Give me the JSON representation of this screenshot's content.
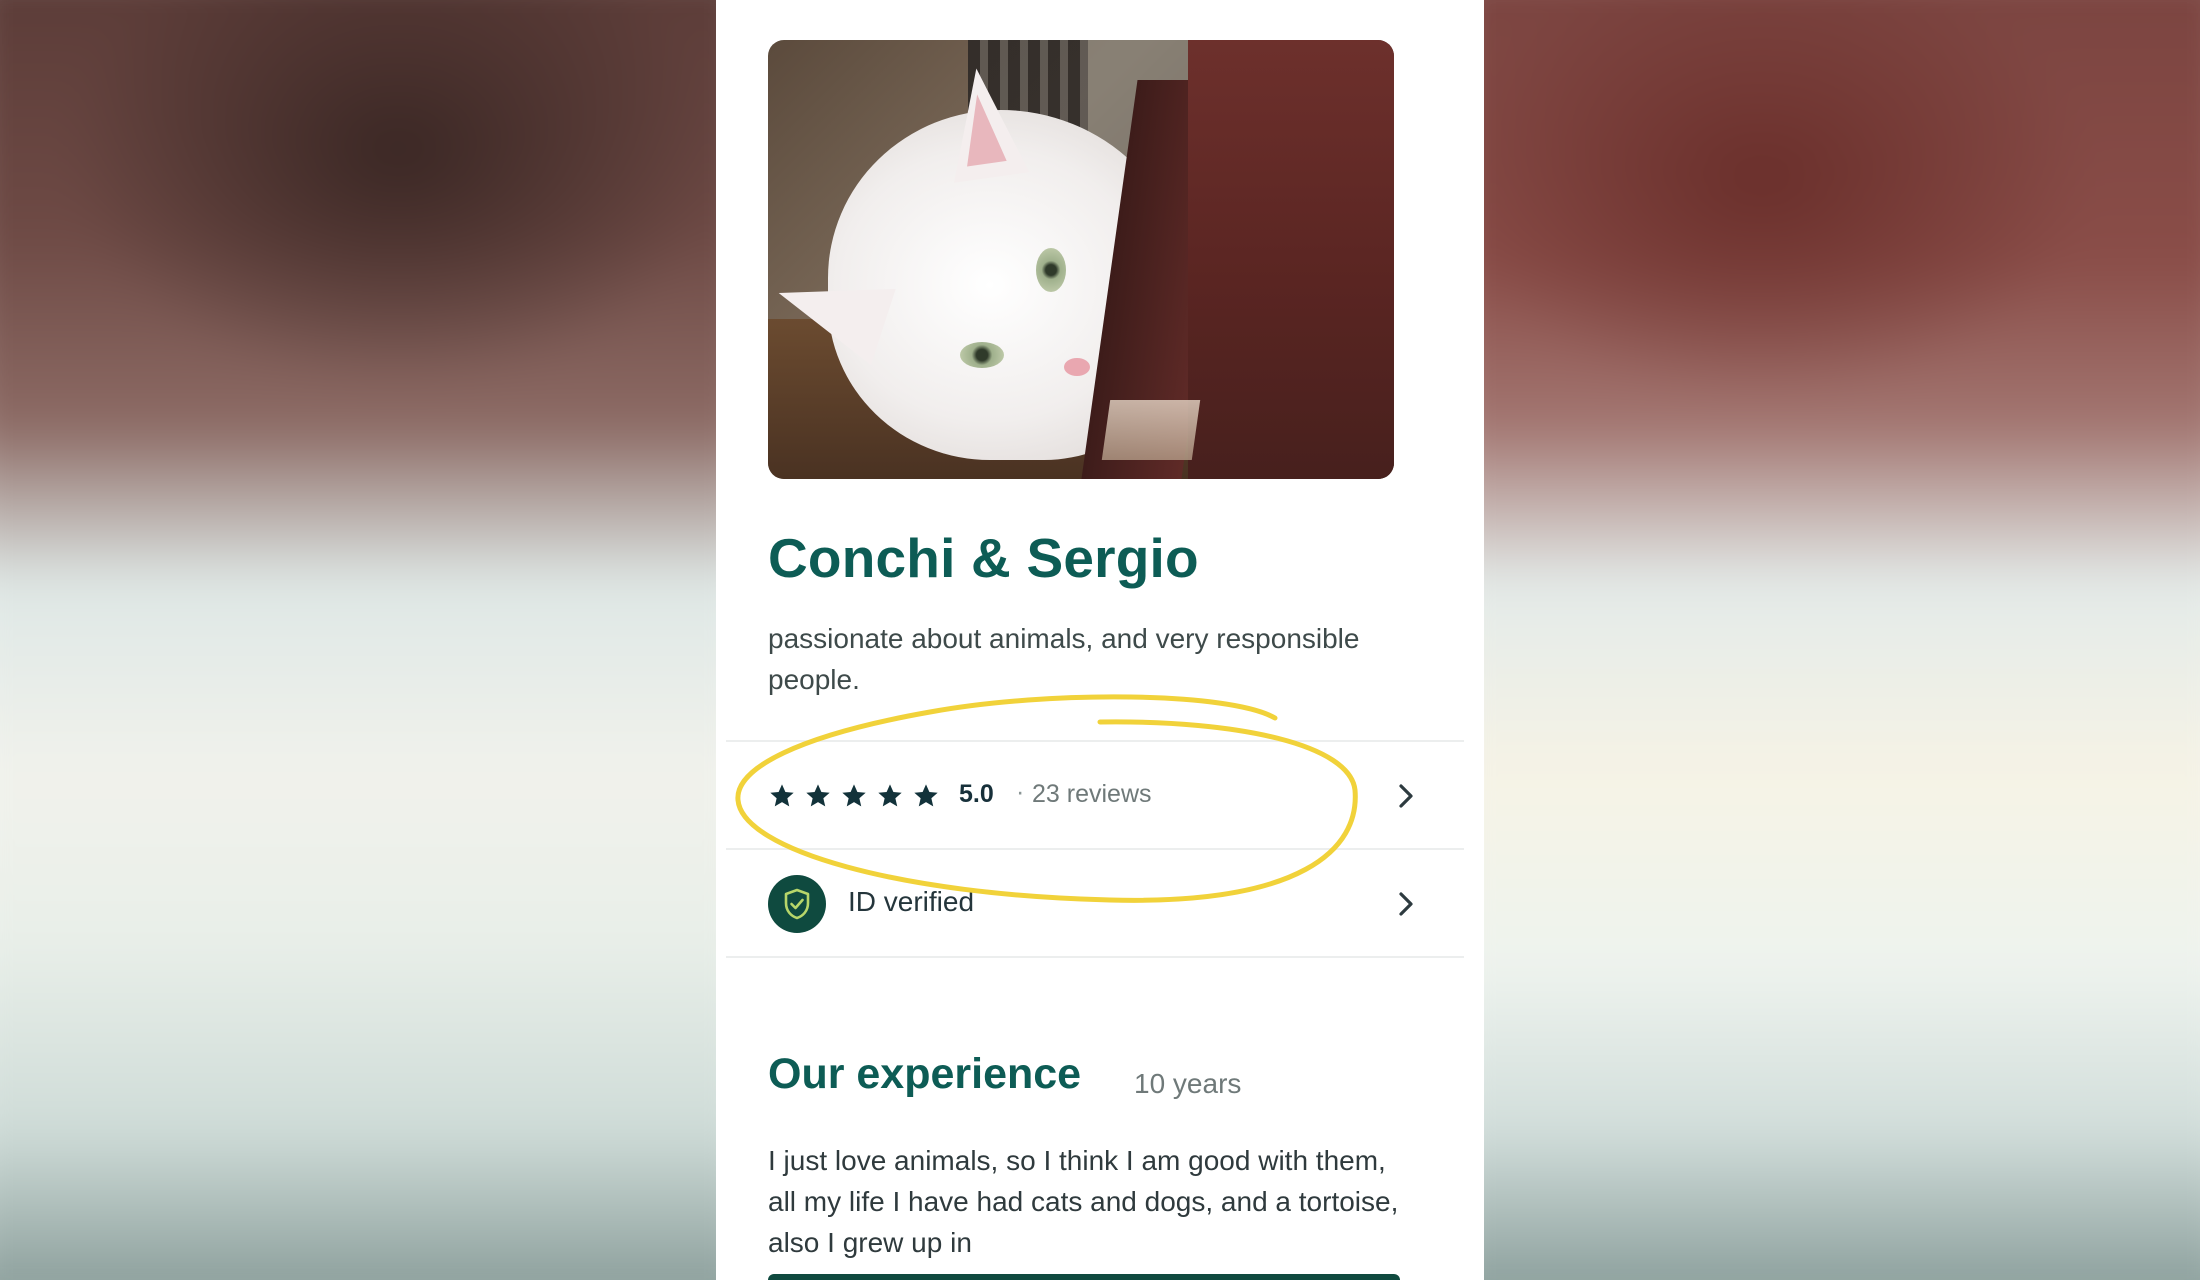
{
  "profile": {
    "name": "Conchi & Sergio",
    "bio": "passionate about animals, and very responsible people."
  },
  "rating": {
    "stars": 5,
    "score": "5.0",
    "separator": "·",
    "reviews": "23 reviews"
  },
  "verification": {
    "label": "ID verified"
  },
  "experience": {
    "title": "Our experience",
    "years": "10 years",
    "text": "I just love animals, so I think I am good with them, all my life I have had cats and dogs, and a tortoise, also I grew up in"
  },
  "colors": {
    "brand": "#0d5c55",
    "badge": "#0f4a3f",
    "annotation": "#f1d23a"
  },
  "icons": [
    "star-icon",
    "shield-check-icon",
    "chevron-right-icon"
  ]
}
